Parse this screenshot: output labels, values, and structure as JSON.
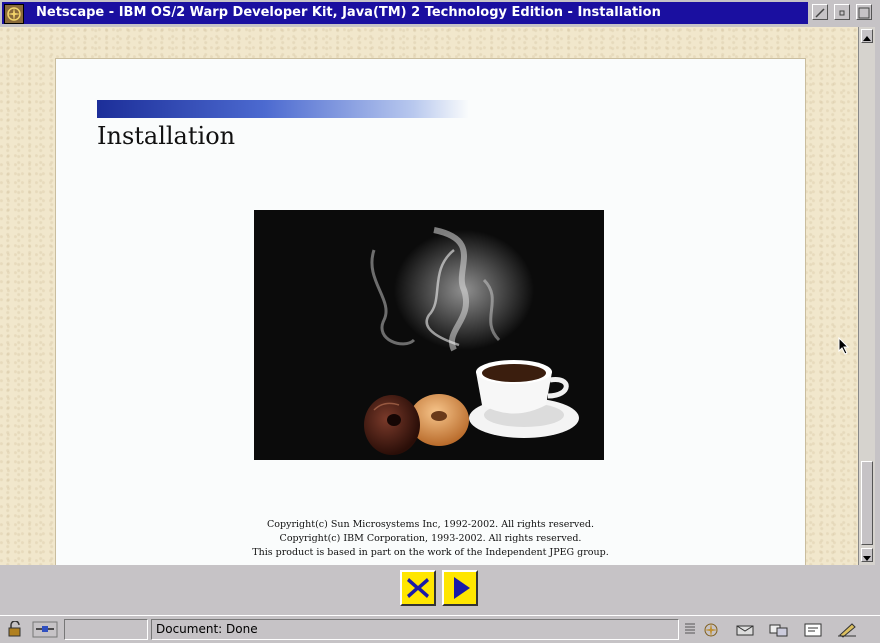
{
  "window": {
    "title": "Netscape - IBM OS/2 Warp Developer Kit, Java(TM) 2 Technology Edition - Installation"
  },
  "page": {
    "heading": "Installation",
    "copyright_lines": [
      "Copyright(c) Sun Microsystems Inc, 1992-2002. All rights reserved.",
      "Copyright(c) IBM Corporation, 1993-2002. All rights reserved.",
      "This product is based in part on the work of the Independent JPEG group."
    ]
  },
  "status": {
    "text": "Document: Done"
  },
  "colors": {
    "titlebar": "#1a0fa0",
    "nav_button": "#ffe600",
    "nav_icon": "#1a1aa8"
  },
  "icons": {
    "app": "netscape-compass-icon",
    "cancel": "x-cancel-icon",
    "next": "play-forward-icon"
  }
}
